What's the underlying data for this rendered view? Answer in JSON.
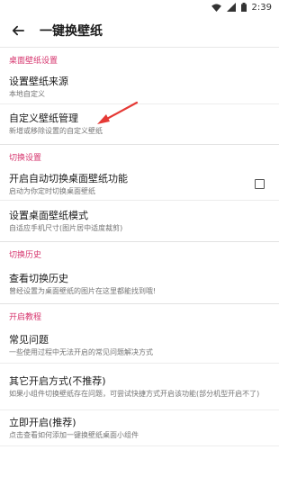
{
  "status_bar": {
    "time": "2:39"
  },
  "app_bar": {
    "title": "一键换壁纸"
  },
  "sections": [
    {
      "header": "桌面壁纸设置",
      "items": [
        {
          "title": "设置壁纸来源",
          "summary": "本地自定义"
        },
        {
          "title": "自定义壁纸管理",
          "summary": "新增或移除设置的自定义壁纸"
        }
      ]
    },
    {
      "header": "切换设置",
      "items": [
        {
          "title": "开启自动切换桌面壁纸功能",
          "summary": "启动为你定时切换桌面壁纸",
          "checkbox": false
        },
        {
          "title": "设置桌面壁纸模式",
          "summary": "自适应手机尺寸(图片居中适度裁剪)"
        }
      ]
    },
    {
      "header": "切换历史",
      "items": [
        {
          "title": "查看切换历史",
          "summary": "曾经设置为桌面壁纸的图片在这里都能找到哦!"
        }
      ]
    },
    {
      "header": "开启教程",
      "items": [
        {
          "title": "常见问题",
          "summary": "一些使用过程中无法开启的常见问题解决方式"
        },
        {
          "title": "其它开启方式(不推荐)",
          "summary": "如果小组件切换壁纸存在问题，可尝试快捷方式开启该功能(部分机型开启不了)"
        },
        {
          "title": "立即开启(推荐)",
          "summary": "点击查看如何添加一键换壁纸桌面小组件"
        }
      ]
    }
  ],
  "colors": {
    "accent": "#d6336c",
    "annotation_arrow": "#e53935"
  }
}
